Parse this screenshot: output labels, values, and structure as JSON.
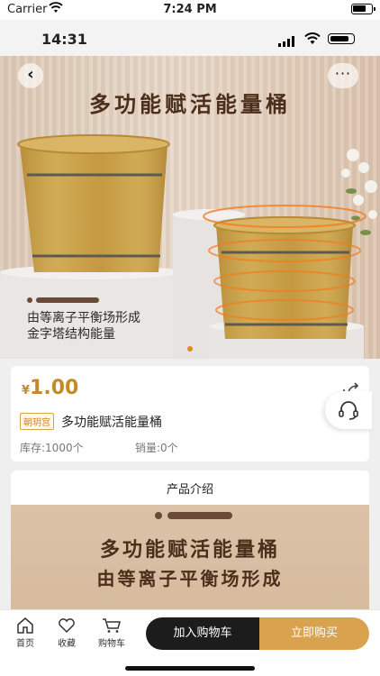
{
  "status_bar": {
    "carrier": "Carrier",
    "time": "7:24 PM"
  },
  "app_status": {
    "time": "14:31"
  },
  "hero": {
    "title": "多功能赋活能量桶",
    "line1": "由等离子平衡场形成",
    "line2": "金字塔结构能量"
  },
  "product": {
    "currency": "¥",
    "price": "1.00",
    "tag": "朝玥宫",
    "name": "多功能赋活能量桶",
    "stock": "库存:1000个",
    "sales": "销量:0个"
  },
  "intro": {
    "title": "产品介绍",
    "heading": "多功能赋活能量桶",
    "subheading": "由等离子平衡场形成"
  },
  "nav": {
    "home": "首页",
    "favorite": "收藏",
    "cart": "购物车"
  },
  "actions": {
    "add_to_cart": "加入购物车",
    "buy_now": "立即购买"
  },
  "colors": {
    "price": "#c48a2a",
    "buy_button": "#d9a24f",
    "cart_button": "#1c1c1c",
    "hero_text": "#4b2f1c"
  },
  "icons": [
    "wifi-icon",
    "battery-icon",
    "signal-icon",
    "back-icon",
    "more-icon",
    "share-icon",
    "headset-icon",
    "home-icon",
    "heart-icon",
    "cart-icon"
  ]
}
